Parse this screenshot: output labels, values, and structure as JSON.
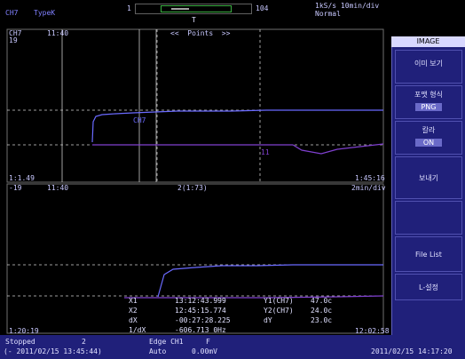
{
  "header": {
    "channel": "CH7",
    "type_label": "TypeK",
    "zoom_left_marker": "1",
    "zoom_right_marker": "104",
    "trigger_marker": "T",
    "sample_rate": "1kS/s 10min/div",
    "mode": "Normal"
  },
  "upper_panel": {
    "top_left_labels": [
      "CH7",
      "19"
    ],
    "top_time_label": "11:40",
    "center_label": "<<  Points  >>",
    "bottom_left": "1:1.49",
    "bottom_right": "1:45:16",
    "trace_label": "CH7",
    "trace_label2": "11"
  },
  "lower_panel": {
    "top_left": "-19",
    "top_mid": "11:40",
    "top_center": "2(1:73)",
    "top_right": "2min/div",
    "bottom_left": "1:20:19",
    "bottom_right": "12:02:58"
  },
  "cursor_readout": {
    "rows": [
      {
        "key": "X1",
        "value": "13:12:43.999",
        "ykey": "Y1(CH7)",
        "yvalue": "47.0c"
      },
      {
        "key": "X2",
        "value": "12:45:15.774",
        "ykey": "Y2(CH7)",
        "yvalue": "24.0c"
      },
      {
        "key": "dX",
        "value": "-00:27:28.225",
        "ykey": "dY",
        "yvalue": "23.0c"
      },
      {
        "key": "1/dX",
        "value": "-606.713 0Hz",
        "ykey": "",
        "yvalue": ""
      }
    ]
  },
  "sidebar": {
    "title": "IMAGE",
    "items": [
      {
        "label": "이미 보기",
        "value": ""
      },
      {
        "label": "포맷 형식",
        "value": "PNG"
      },
      {
        "label": "칼라",
        "value": "ON"
      },
      {
        "label": "보내기",
        "value": ""
      },
      {
        "label": "",
        "value": ""
      },
      {
        "label": "File List",
        "value": ""
      },
      {
        "label": "L-설정",
        "value": ""
      }
    ]
  },
  "status": {
    "state": "Stopped",
    "count": "2",
    "trigger_type": "Edge CH1",
    "trigger_slope": "F",
    "start_time": "(- 2011/02/15 13:45:44)",
    "trigger_mode": "Auto",
    "trigger_level": "0.00mV",
    "clock": "2011/02/15 14:17:20"
  },
  "colors": {
    "trace": "#6a6aff",
    "trace2": "#8040d0",
    "accent": "#20207a"
  }
}
